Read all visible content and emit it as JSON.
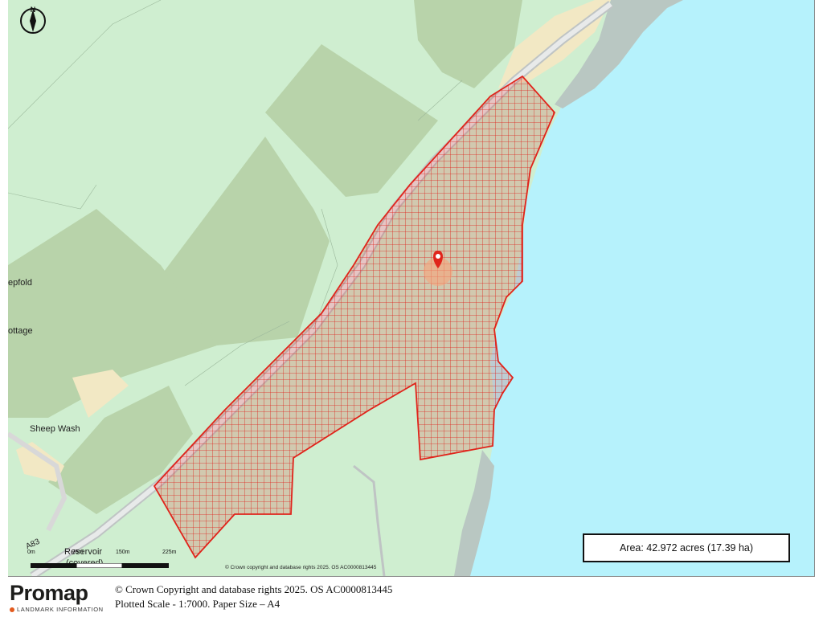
{
  "map": {
    "place_labels": {
      "sheepfold": "epfold",
      "cottage": "ottage",
      "sheep_wash": "Sheep Wash",
      "reservoir": "Reservoir",
      "covered": "(covered)",
      "road": "A83"
    },
    "scale_bar": {
      "ticks": [
        "0m",
        "75m",
        "150m",
        "225m"
      ]
    },
    "map_copyright": "© Crown copyright and database rights 2025. OS AC0000813445",
    "area": "Area: 42.972 acres (17.39 ha)",
    "compass_label": "N",
    "colors": {
      "sea": "#b6f2fc",
      "land": "#cdeccd",
      "woodland": "#b7d4a9",
      "boundary": "#e0241b"
    }
  },
  "footer": {
    "brand": "Promap",
    "brand_sub": "LANDMARK INFORMATION",
    "copyright": "© Crown Copyright and database rights 2025. OS AC0000813445",
    "scale_text": "Plotted Scale - 1:7000. Paper Size – A4"
  }
}
